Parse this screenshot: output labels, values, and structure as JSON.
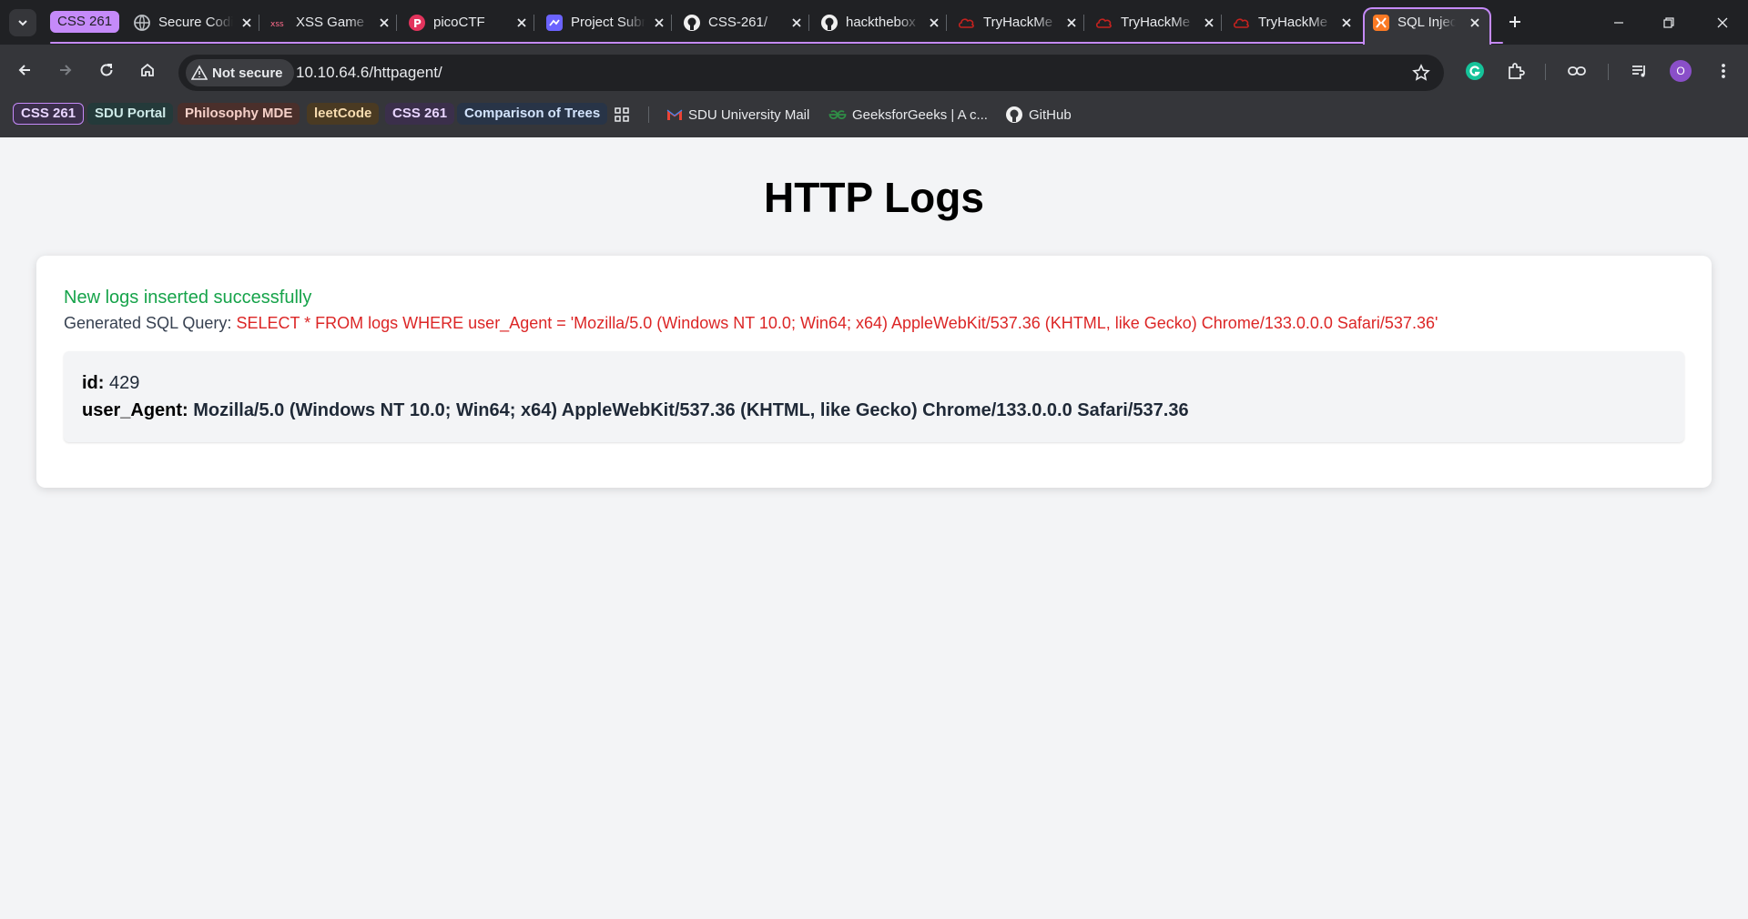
{
  "browser": {
    "tab_group": {
      "label": "CSS 261",
      "color": "#c58af9"
    },
    "tabs": [
      {
        "title": "Secure Coding",
        "icon": "globe-icon"
      },
      {
        "title": "XSS Game",
        "icon": "xss-game-icon"
      },
      {
        "title": "picoCTF",
        "icon": "picoctf-icon"
      },
      {
        "title": "Project Submission",
        "icon": "project-icon"
      },
      {
        "title": "CSS-261/",
        "icon": "github-icon"
      },
      {
        "title": "hackthebox",
        "icon": "github-icon"
      },
      {
        "title": "TryHackMe",
        "icon": "tryhackme-icon"
      },
      {
        "title": "TryHackMe",
        "icon": "tryhackme-icon"
      },
      {
        "title": "TryHackMe",
        "icon": "tryhackme-icon"
      },
      {
        "title": "SQL Injection",
        "icon": "xampp-icon",
        "active": true
      }
    ],
    "address_bar": {
      "security_label": "Not secure",
      "url": "10.10.64.6/httpagent/"
    },
    "profile_initial": "O",
    "bookmarks": {
      "chips": [
        {
          "label": "CSS 261",
          "bg": "#3b2f4b",
          "fg": "#e8d5ff",
          "outline": "#c58af9"
        },
        {
          "label": "SDU Portal",
          "bg": "#243a3a",
          "fg": "#cde9e7"
        },
        {
          "label": "Philosophy MDE",
          "bg": "#4a2f2b",
          "fg": "#f5d0c8"
        },
        {
          "label": "leetCode",
          "bg": "#4a3a22",
          "fg": "#f7dcb0"
        },
        {
          "label": "CSS 261",
          "bg": "#3b2f4b",
          "fg": "#e8d5ff"
        },
        {
          "label": "Comparison of Trees",
          "bg": "#283447",
          "fg": "#d2e3fc"
        }
      ],
      "links": [
        {
          "label": "SDU University Mail",
          "icon": "gmail-icon"
        },
        {
          "label": "GeeksforGeeks | A c...",
          "icon": "geeksforgeeks-icon"
        },
        {
          "label": "GitHub",
          "icon": "github-icon"
        }
      ]
    }
  },
  "page": {
    "title": "HTTP Logs",
    "success_message": "New logs inserted successfully",
    "query_label": "Generated SQL Query:",
    "query": "SELECT * FROM logs WHERE user_Agent = 'Mozilla/5.0 (Windows NT 10.0; Win64; x64) AppleWebKit/537.36 (KHTML, like Gecko) Chrome/133.0.0.0 Safari/537.36'",
    "result": {
      "id_label": "id:",
      "id": "429",
      "agent_label": "user_Agent:",
      "agent": "Mozilla/5.0 (Windows NT 10.0; Win64; x64) AppleWebKit/537.36 (KHTML, like Gecko) Chrome/133.0.0.0 Safari/537.36"
    }
  }
}
